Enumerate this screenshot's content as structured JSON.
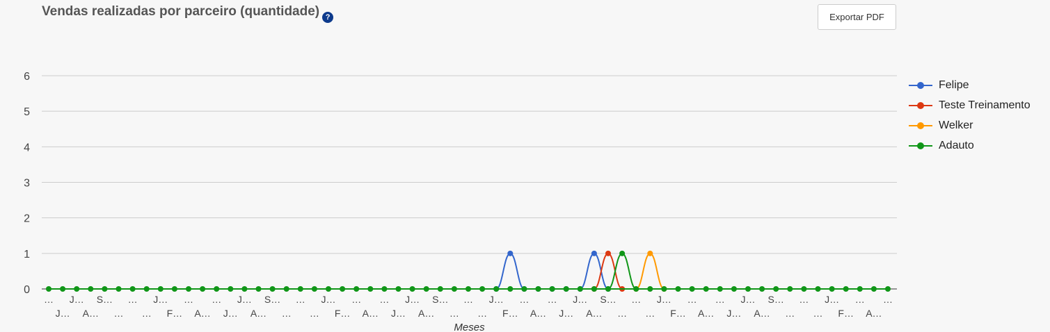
{
  "title": "Vendas realizadas por parceiro (quantidade)",
  "help_icon_glyph": "?",
  "export_label": "Exportar PDF",
  "chart_data": {
    "type": "line",
    "title": "Vendas realizadas por parceiro (quantidade)",
    "xlabel": "Meses",
    "ylabel": "",
    "ylim": [
      0,
      6
    ],
    "yticks": [
      0,
      1,
      2,
      3,
      4,
      5,
      6
    ],
    "grid": true,
    "legend_position": "right",
    "num_points": 61,
    "x_tick_labels": [
      "…",
      "J…",
      "J…",
      "A…",
      "S…",
      "…",
      "…",
      "…",
      "J…",
      "F…",
      "…",
      "A…",
      "…",
      "J…",
      "J…",
      "A…",
      "S…",
      "…",
      "…",
      "…",
      "J…",
      "F…",
      "…",
      "A…",
      "…",
      "J…",
      "J…",
      "A…",
      "S…",
      "…",
      "…",
      "…",
      "J…",
      "F…",
      "…",
      "A…",
      "…",
      "J…",
      "J…",
      "A…",
      "S…",
      "…",
      "…",
      "…",
      "J…",
      "F…",
      "…",
      "A…",
      "…",
      "J…",
      "J…",
      "A…",
      "S…",
      "…",
      "…",
      "…",
      "J…",
      "F…",
      "…",
      "A…",
      "…"
    ],
    "series": [
      {
        "name": "Felipe",
        "color": "#3366cc",
        "nonzero": {
          "33": 1,
          "39": 1
        }
      },
      {
        "name": "Teste Treinamento",
        "color": "#dc3912",
        "nonzero": {
          "40": 1
        }
      },
      {
        "name": "Welker",
        "color": "#ff9900",
        "nonzero": {
          "43": 1
        }
      },
      {
        "name": "Adauto",
        "color": "#109618",
        "nonzero": {
          "41": 1
        }
      }
    ]
  }
}
